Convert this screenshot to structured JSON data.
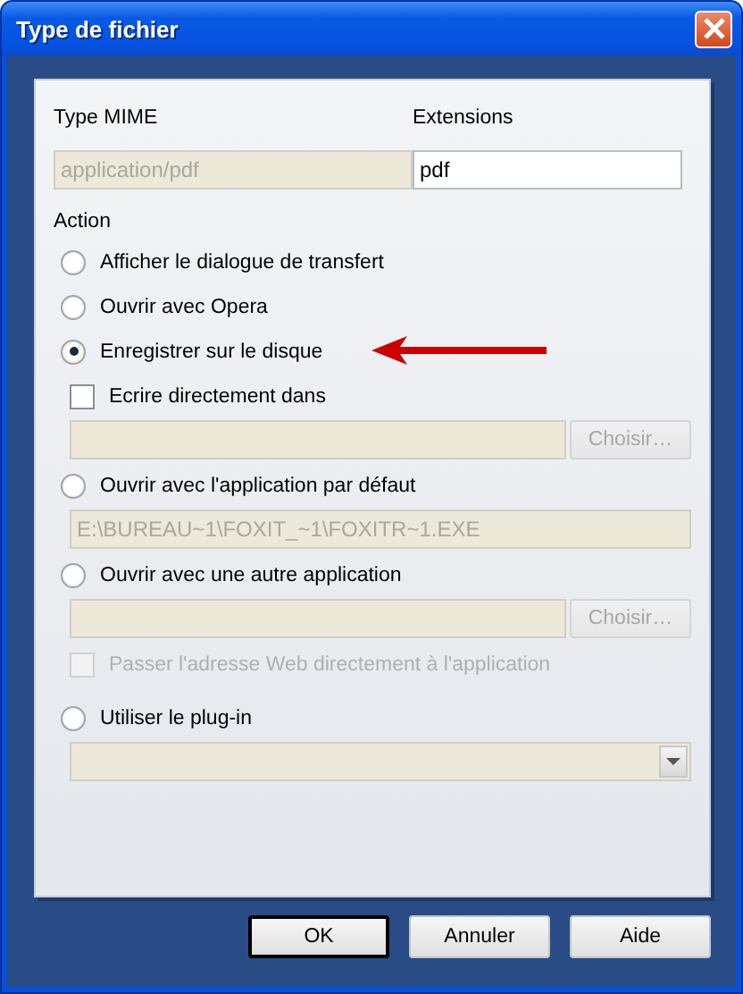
{
  "window": {
    "title": "Type de fichier"
  },
  "mime": {
    "label": "Type MIME",
    "value": "application/pdf",
    "disabled": true
  },
  "extensions": {
    "label": "Extensions",
    "value": "pdf",
    "disabled": false
  },
  "action": {
    "label": "Action",
    "items": [
      {
        "kind": "radio",
        "label": "Afficher le dialogue de transfert",
        "selected": false
      },
      {
        "kind": "radio",
        "label": "Ouvrir avec Opera",
        "selected": false
      },
      {
        "kind": "radio",
        "label": "Enregistrer sur le disque",
        "selected": true,
        "annotated": true
      },
      {
        "kind": "checkbox",
        "label": "Ecrire directement dans",
        "checked": false,
        "disabled": false
      },
      {
        "kind": "path",
        "disabled": true,
        "button": {
          "label": "Choisir…",
          "disabled": true
        }
      },
      {
        "kind": "radio",
        "label": "Ouvrir avec l'application par défaut",
        "selected": false
      },
      {
        "kind": "path",
        "value": "E:\\BUREAU~1\\FOXIT_~1\\FOXITR~1.EXE",
        "disabled": true
      },
      {
        "kind": "radio",
        "label": "Ouvrir avec une autre application",
        "selected": false
      },
      {
        "kind": "path",
        "disabled": true,
        "button": {
          "label": "Choisir…",
          "disabled": true
        }
      },
      {
        "kind": "checkbox",
        "label": "Passer l'adresse Web directement à l'application",
        "checked": false,
        "disabled": true
      },
      {
        "kind": "radio",
        "label": "Utiliser le plug-in",
        "selected": false,
        "gap": true
      },
      {
        "kind": "select",
        "disabled": true
      }
    ]
  },
  "buttons": [
    {
      "label": "OK",
      "default": true
    },
    {
      "label": "Annuler",
      "default": false
    },
    {
      "label": "Aide",
      "default": false
    }
  ]
}
